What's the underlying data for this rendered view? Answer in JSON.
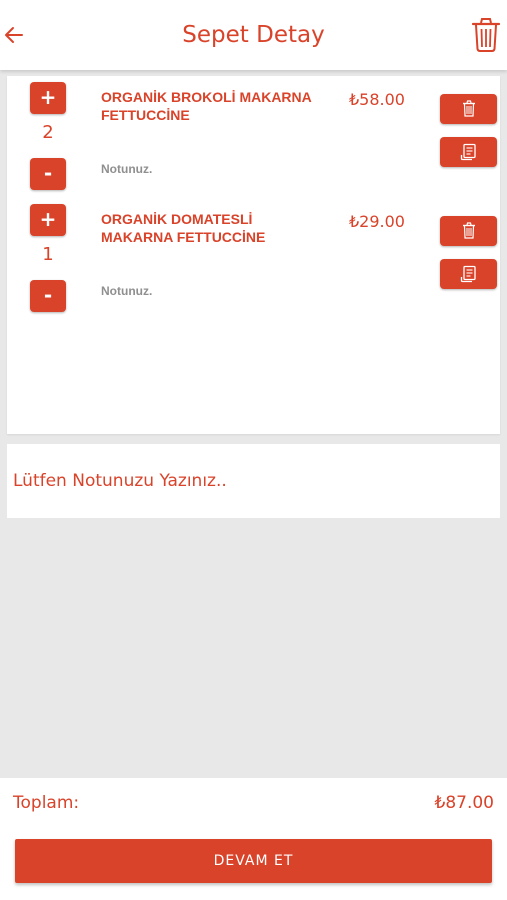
{
  "header": {
    "title": "Sepet Detay",
    "back_icon": "arrow-left-icon",
    "action_icon": "trash-icon"
  },
  "cart": {
    "items": [
      {
        "quantity": "2",
        "name": "ORGANİK BROKOLİ MAKARNA FETTUCCİNE",
        "price": "₺58.00",
        "note": "Notunuz."
      },
      {
        "quantity": "1",
        "name": "ORGANİK DOMATESLİ MAKARNA FETTUCCİNE",
        "price": "₺29.00",
        "note": "Notunuz."
      }
    ],
    "plus_label": "+",
    "minus_label": "-"
  },
  "note": {
    "placeholder": "Lütfen Notunuzu Yazınız.."
  },
  "footer": {
    "total_label": "Toplam:",
    "total_value": "₺87.00",
    "continue_label": "DEVAM ET"
  },
  "colors": {
    "accent": "#d9432a",
    "background": "#e8e8e8",
    "surface": "#ffffff",
    "note_text": "#8f8f8f"
  }
}
